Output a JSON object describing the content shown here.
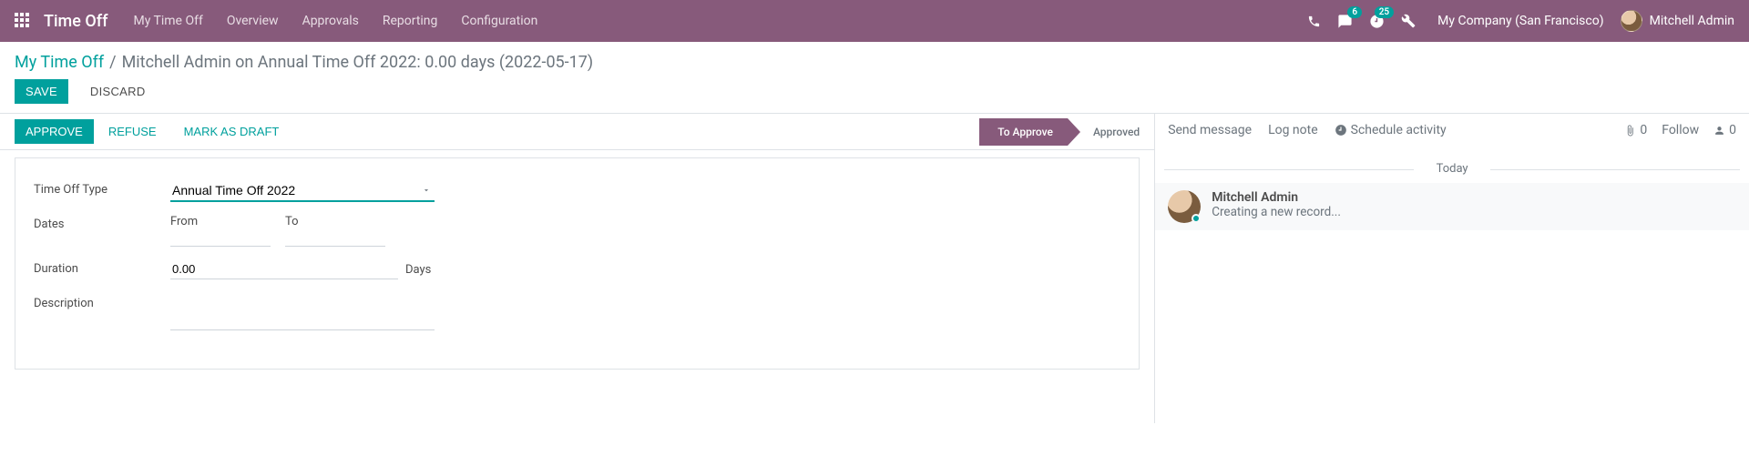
{
  "topbar": {
    "brand": "Time Off",
    "menu": [
      "My Time Off",
      "Overview",
      "Approvals",
      "Reporting",
      "Configuration"
    ],
    "messages_badge": "6",
    "activities_badge": "25",
    "company": "My Company (San Francisco)",
    "user": "Mitchell Admin"
  },
  "breadcrumb": {
    "root": "My Time Off",
    "current": "Mitchell Admin on Annual Time Off 2022: 0.00 days (2022-05-17)"
  },
  "buttons": {
    "save": "Save",
    "discard": "Discard",
    "approve": "Approve",
    "refuse": "Refuse",
    "mark_draft": "Mark as Draft"
  },
  "status": {
    "to_approve": "To Approve",
    "approved": "Approved"
  },
  "form": {
    "type_label": "Time Off Type",
    "type_value": "Annual Time Off 2022",
    "dates_label": "Dates",
    "from_label": "From",
    "to_label": "To",
    "from_value": "",
    "to_value": "",
    "duration_label": "Duration",
    "duration_value": "0.00",
    "duration_unit": "Days",
    "description_label": "Description",
    "description_value": ""
  },
  "chatter": {
    "send": "Send message",
    "log": "Log note",
    "schedule": "Schedule activity",
    "attach_count": "0",
    "follow": "Follow",
    "follower_count": "0",
    "today": "Today",
    "msg_author": "Mitchell Admin",
    "msg_text": "Creating a new record..."
  }
}
